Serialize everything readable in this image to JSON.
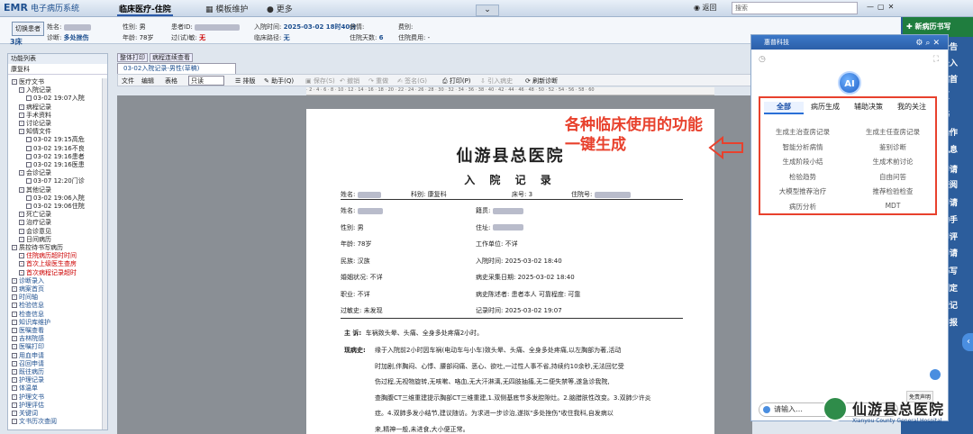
{
  "top": {
    "app_name": "EMR",
    "app_subtitle": "电子病历系统",
    "tab_active": "临床医疗-住院",
    "tab_template": "模板维护",
    "tab_more": "更多",
    "back_label": "返回",
    "search_placeholder": "搜索"
  },
  "patient": {
    "switch_label": "切换患者",
    "bed": "3床",
    "name_label": "姓名:",
    "diag_label": "诊断:",
    "diag_value": "多处挫伤",
    "sex_label": "性别:",
    "sex_value": "男",
    "age_label": "年龄:",
    "age_value": "78岁",
    "pid_label": "患者ID:",
    "allergy_label": "过(试)敏:",
    "allergy_value": "无",
    "admit_label": "入院时间:",
    "admit_value": "2025-03-02 18时40分",
    "illness_label": "病情:",
    "path_label": "临床路径:",
    "path_value": "无",
    "days_label": "住院天数:",
    "days_value": "6",
    "fee_label": "费别:",
    "balance_label": "住院费用:",
    "balance_value": "-"
  },
  "rightstrip": {
    "new_button": "新病历书写",
    "items": [
      "公告",
      "录入",
      "病首",
      "页",
      "书",
      "操作",
      "讯息",
      "申请",
      "查阅",
      "申请",
      "助手",
      "申评",
      "申请",
      "书写",
      "判定",
      "登记",
      "申报"
    ]
  },
  "left": {
    "header": "功能列表",
    "dept": "康复科",
    "tree": [
      {
        "t": "医疗文书",
        "c": ""
      },
      {
        "t": "入院记录",
        "c": ""
      },
      {
        "t": "03-02 19:07入院",
        "c": ""
      },
      {
        "t": "病程记录",
        "c": ""
      },
      {
        "t": "手术资料",
        "c": ""
      },
      {
        "t": "讨论记录",
        "c": ""
      },
      {
        "t": "知情文件",
        "c": ""
      },
      {
        "t": "03-02 19:15高危",
        "c": ""
      },
      {
        "t": "03-02 19:16不良",
        "c": ""
      },
      {
        "t": "03-02 19:16患者",
        "c": ""
      },
      {
        "t": "03-02 19:16医患",
        "c": ""
      },
      {
        "t": "会诊记录",
        "c": ""
      },
      {
        "t": "03-07 12:20门诊",
        "c": ""
      },
      {
        "t": "其他记录",
        "c": ""
      },
      {
        "t": "03-02 19:06入院",
        "c": ""
      },
      {
        "t": "03-02 19:06住院",
        "c": ""
      },
      {
        "t": "死亡记录",
        "c": ""
      },
      {
        "t": "治疗记录",
        "c": ""
      },
      {
        "t": "会诊意见",
        "c": ""
      },
      {
        "t": "日间病历",
        "c": ""
      },
      {
        "t": "质控待书写病历",
        "c": ""
      },
      {
        "t": "住院病历超时时间",
        "c": "red"
      },
      {
        "t": "首次上级医生查房",
        "c": "red"
      },
      {
        "t": "首次病程记录超时",
        "c": "red"
      },
      {
        "t": "诊断录入",
        "c": "blue"
      },
      {
        "t": "病案首页",
        "c": "blue"
      },
      {
        "t": "时间轴",
        "c": "blue"
      },
      {
        "t": "检验信息",
        "c": "blue"
      },
      {
        "t": "检查信息",
        "c": "blue"
      },
      {
        "t": "知识库维护",
        "c": "blue"
      },
      {
        "t": "医嘱查看",
        "c": "blue"
      },
      {
        "t": "吉林院感",
        "c": "blue"
      },
      {
        "t": "医嘱打印",
        "c": "blue"
      },
      {
        "t": "用血申请",
        "c": "blue"
      },
      {
        "t": "召回申请",
        "c": "blue"
      },
      {
        "t": "既往病历",
        "c": "blue"
      },
      {
        "t": "护理记录",
        "c": "blue"
      },
      {
        "t": "体温单",
        "c": "blue"
      },
      {
        "t": "护理文书",
        "c": "blue"
      },
      {
        "t": "护理评估",
        "c": "blue"
      },
      {
        "t": "关键词",
        "c": "blue"
      },
      {
        "t": "文书历次查阅",
        "c": "blue"
      }
    ]
  },
  "editor": {
    "tabs": [
      "整体打印",
      "病程连续查看"
    ],
    "doc_tab": "03-02入院记录-男性(草稿)",
    "menu_file": "文件",
    "menu_edit": "编辑",
    "menu_table": "表格",
    "readonly": "只读",
    "typeset": "排版",
    "assistant": "助手(Q)",
    "save": "保存(S)",
    "undo": "撤销",
    "redo": "重做",
    "sign": "签名(G)",
    "print": "打印(P)",
    "import": "引入病史",
    "refresh": "刷新诊断",
    "ruler": "· 2 · 4 · 6 · 8 · 10 · 12 · 14 · 16 · 18 · 20 · 22 · 24 · 26 · 28 · 30 · 32 · 34 · 36 · 38 · 40 · 42 · 44 · 46 · 48 · 50 · 52 · 54 · 56 · 58 · 60"
  },
  "paper": {
    "hospital": "仙游县总医院",
    "title": "入 院 记 录",
    "name_label": "姓名:",
    "dept_label": "科别:",
    "dept_value": "康复科",
    "bed_label": "床号:",
    "bed_value": "3",
    "no_label": "住院号:",
    "rows": [
      {
        "l": "姓名:",
        "v": "",
        "r": "籍贯:",
        "rv": ""
      },
      {
        "l": "性别:",
        "v": "男",
        "r": "住址:",
        "rv": ""
      },
      {
        "l": "年龄:",
        "v": "78岁",
        "r": "工作单位:",
        "rv": "不详"
      },
      {
        "l": "民族:",
        "v": "汉族",
        "r": "入院时间:",
        "rv": "2025-03-02 18:40"
      },
      {
        "l": "婚姻状况:",
        "v": "不详",
        "r": "病史采集日期:",
        "rv": "2025-03-02 18:40"
      },
      {
        "l": "职业:",
        "v": "不详",
        "r": "病史陈述者:",
        "rv": "患者本人  可靠程度: 可靠"
      },
      {
        "l": "过敏史:",
        "v": "未发现",
        "r": "记录时间:",
        "rv": "2025-03-02 19:07"
      }
    ],
    "chief_label": "主  诉:",
    "chief_text": "车祸致头晕、头痛、全身多处疼痛2小时。",
    "hpi_label": "现病史:",
    "hpi_lines": [
      "缘于入院前2小时因车祸(电动车与小车)致头晕、头痛、全身多处疼痛,以左胸部为著,活动",
      "时加剧,伴胸闷、心悸、腰部闷痛、恶心、欲吐,一过性人事不省,持续约10余秒,无法回忆受",
      "伤过程,无视物旋转,无咳嗽、咯血,无大汗淋漓,无四肢抽搐,无二便失禁等,遂急诊我院,",
      "查胸腹CT三维重建提示胸部CT三维重建,1.双侧基底节多发腔隙灶。2.脑腊肤性改变。3.双肺少许炎",
      "症。4.双肺多发小结节,建议随访。为求进一步诊治,遂拟\"多处挫伤\"收住我科,自发病以",
      "来,精神一般,未进食,大小便正常。"
    ]
  },
  "annotation": {
    "text": "各种临床使用的功能一键生成"
  },
  "ai": {
    "header": "惠普科技",
    "logo": "AI",
    "tabs": [
      "全部",
      "病历生成",
      "辅助决策",
      "我的关注"
    ],
    "functions": [
      "生成主治查房记录",
      "生成主任查房记录",
      "智能分析病情",
      "鉴别诊断",
      "生成阶段小结",
      "生成术前讨论",
      "检验趋势",
      "自由问答",
      "大模型推荐治疗",
      "推荐检验检查",
      "病历分析",
      "MDT"
    ],
    "input_placeholder": "请输入…",
    "disclaimer": "免责声明"
  },
  "watermark": {
    "name": "仙游县总医院",
    "en": "Xianyou County General Hospital"
  }
}
